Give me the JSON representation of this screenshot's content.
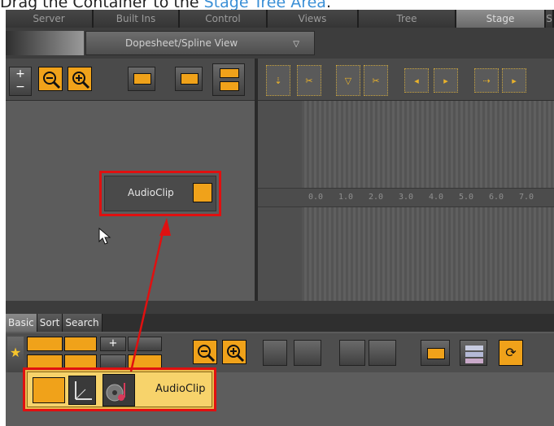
{
  "instruction": {
    "before": "Drag the Container to the ",
    "link": "Stage Tree Area",
    "after": "."
  },
  "tabs": [
    "Server",
    "Built Ins",
    "Control",
    "Views",
    "Tree",
    "Stage",
    "S"
  ],
  "active_tab": "Stage",
  "view_selector": "Dopesheet/Spline View",
  "timeline_ticks": [
    "0.0",
    "1.0",
    "2.0",
    "3.0",
    "4.0",
    "5.0",
    "6.0",
    "7.0"
  ],
  "clip_node_label": "AudioClip",
  "bottom_tabs": [
    "Basic",
    "Sort",
    "Search"
  ],
  "active_bottom_tab": "Basic",
  "container_label": "AudioClip",
  "colors": {
    "highlight": "#e01010",
    "accent": "#f0a21a",
    "link": "#3a8fd6"
  }
}
